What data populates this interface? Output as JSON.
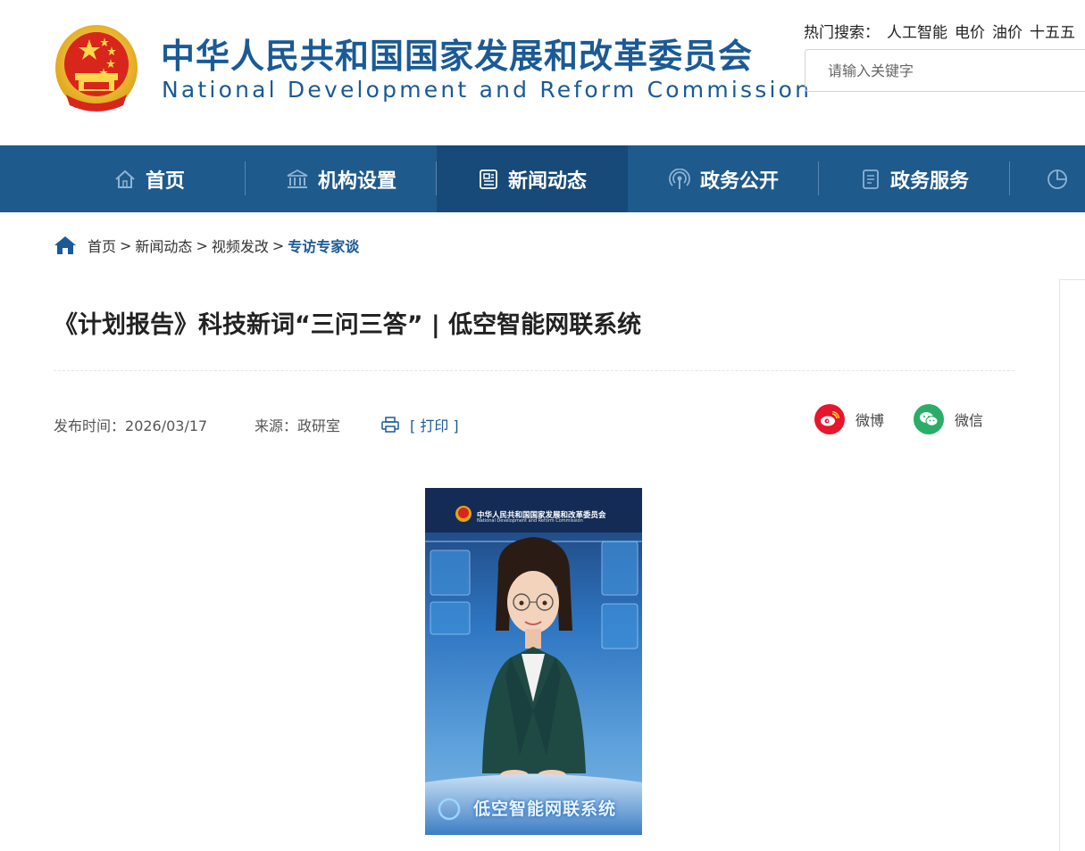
{
  "header": {
    "site_name_cn": "中华人民共和国国家发展和改革委员会",
    "site_name_en": "National Development and Reform Commission",
    "hot_search_label": "热门搜索：",
    "hot_keywords": [
      "人工智能",
      "电价",
      "油价",
      "十五五"
    ],
    "search_placeholder": "请输入关键字"
  },
  "nav": {
    "items": [
      {
        "label": "首页",
        "icon": "home-icon"
      },
      {
        "label": "机构设置",
        "icon": "institution-icon"
      },
      {
        "label": "新闻动态",
        "icon": "news-icon",
        "active": true
      },
      {
        "label": "政务公开",
        "icon": "broadcast-icon"
      },
      {
        "label": "政务服务",
        "icon": "document-icon"
      },
      {
        "label": "",
        "icon": "pie-chart-icon"
      }
    ]
  },
  "breadcrumb": {
    "items": [
      "首页",
      "新闻动态",
      "视频发改",
      "专访专家谈"
    ],
    "separator": ">"
  },
  "article": {
    "title": "《计划报告》科技新词“三问三答” | 低空智能网联系统",
    "publish_label": "发布时间：",
    "publish_date": "2026/03/17",
    "source_label": "来源：",
    "source": "政研室",
    "print_label": "[ 打印 ]",
    "share": {
      "weibo": "微博",
      "wechat": "微信"
    },
    "video": {
      "banner_cn": "中华人民共和国国家发展和改革委员会",
      "banner_en": "National Development and Reform Commission",
      "caption": "低空智能网联系统"
    }
  },
  "colors": {
    "brand_blue": "#1a5a96",
    "nav_bg": "#1e5a8c",
    "nav_active": "#174a78",
    "weibo_red": "#e6162d",
    "wechat_green": "#2aae67"
  }
}
